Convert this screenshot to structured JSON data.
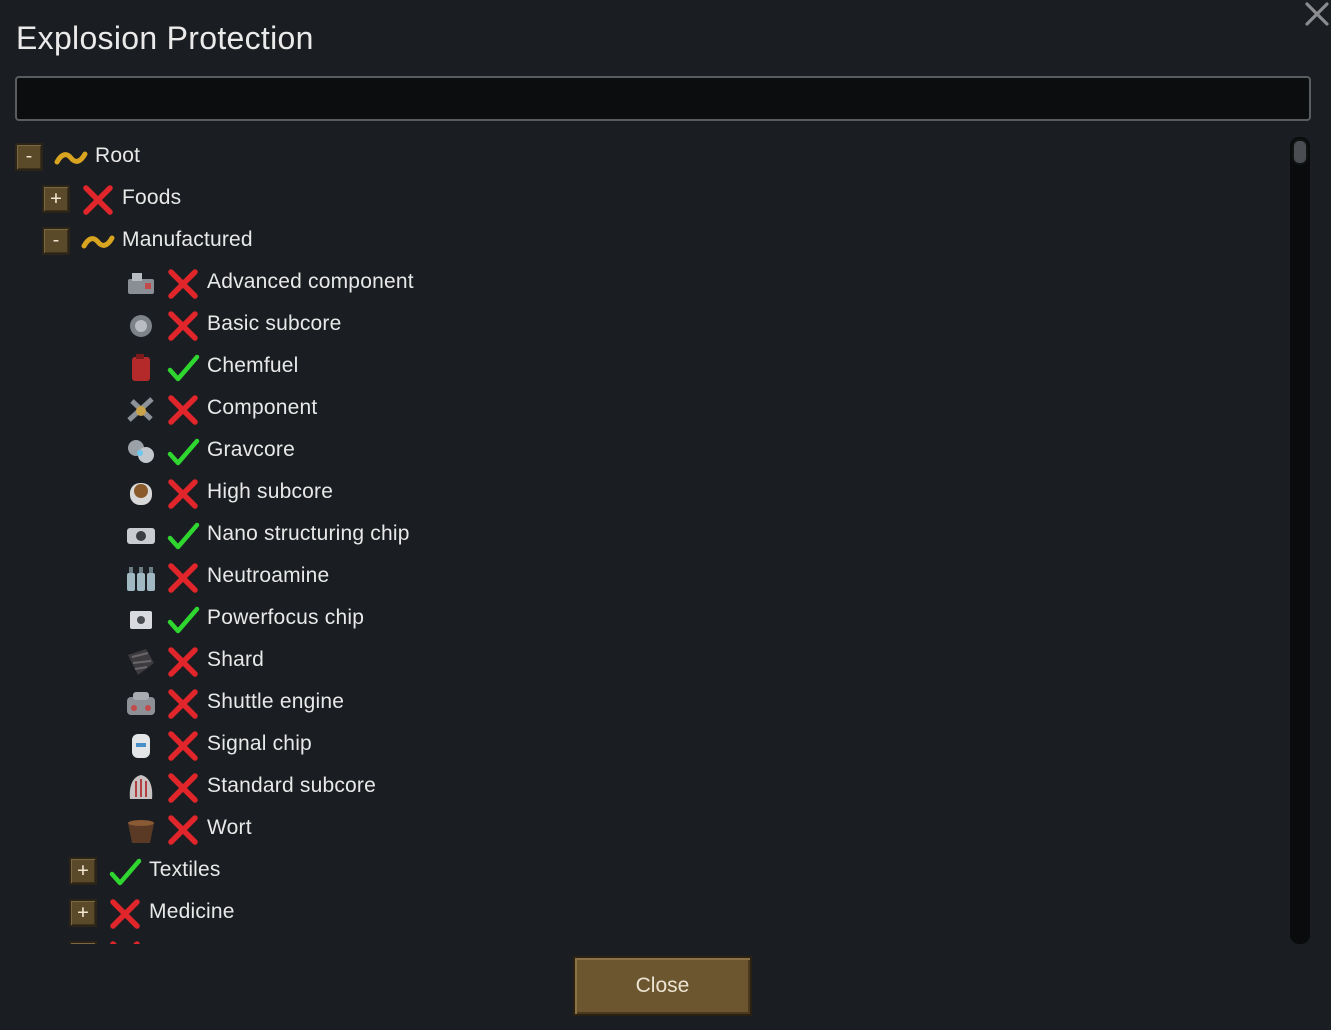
{
  "dialog": {
    "title": "Explosion Protection",
    "search": {
      "value": "",
      "placeholder": ""
    },
    "close_button_label": "Close"
  },
  "tree": [
    {
      "label": "Root",
      "level": 0,
      "toggle": "-",
      "status": "partial"
    },
    {
      "label": "Foods",
      "level": 1,
      "toggle": "+",
      "status": "disallowed"
    },
    {
      "label": "Manufactured",
      "level": 1,
      "toggle": "-",
      "status": "partial"
    },
    {
      "label": "Advanced component",
      "level": 2,
      "status": "disallowed",
      "icon": "advanced-component-icon"
    },
    {
      "label": "Basic subcore",
      "level": 2,
      "status": "disallowed",
      "icon": "basic-subcore-icon"
    },
    {
      "label": "Chemfuel",
      "level": 2,
      "status": "allowed",
      "icon": "chemfuel-icon"
    },
    {
      "label": "Component",
      "level": 2,
      "status": "disallowed",
      "icon": "component-icon"
    },
    {
      "label": "Gravcore",
      "level": 2,
      "status": "allowed",
      "icon": "gravcore-icon"
    },
    {
      "label": "High subcore",
      "level": 2,
      "status": "disallowed",
      "icon": "high-subcore-icon"
    },
    {
      "label": "Nano structuring chip",
      "level": 2,
      "status": "allowed",
      "icon": "nano-structuring-chip-icon"
    },
    {
      "label": "Neutroamine",
      "level": 2,
      "status": "disallowed",
      "icon": "neutroamine-icon"
    },
    {
      "label": "Powerfocus chip",
      "level": 2,
      "status": "allowed",
      "icon": "powerfocus-chip-icon"
    },
    {
      "label": "Shard",
      "level": 2,
      "status": "disallowed",
      "icon": "shard-icon"
    },
    {
      "label": "Shuttle engine",
      "level": 2,
      "status": "disallowed",
      "icon": "shuttle-engine-icon"
    },
    {
      "label": "Signal chip",
      "level": 2,
      "status": "disallowed",
      "icon": "signal-chip-icon"
    },
    {
      "label": "Standard subcore",
      "level": 2,
      "status": "disallowed",
      "icon": "standard-subcore-icon"
    },
    {
      "label": "Wort",
      "level": 2,
      "status": "disallowed",
      "icon": "wort-icon"
    },
    {
      "label": "Textiles",
      "level": 2,
      "toggle": "+",
      "status": "allowed"
    },
    {
      "label": "Medicine",
      "level": 2,
      "toggle": "+",
      "status": "disallowed"
    },
    {
      "label": "",
      "level": 2,
      "toggle": "+",
      "status": "disallowed"
    }
  ],
  "colors": {
    "background": "#1a1d21",
    "allowed": "#2fd62f",
    "disallowed": "#e0262a",
    "partial": "#d9a521",
    "button": "#6b5630"
  }
}
